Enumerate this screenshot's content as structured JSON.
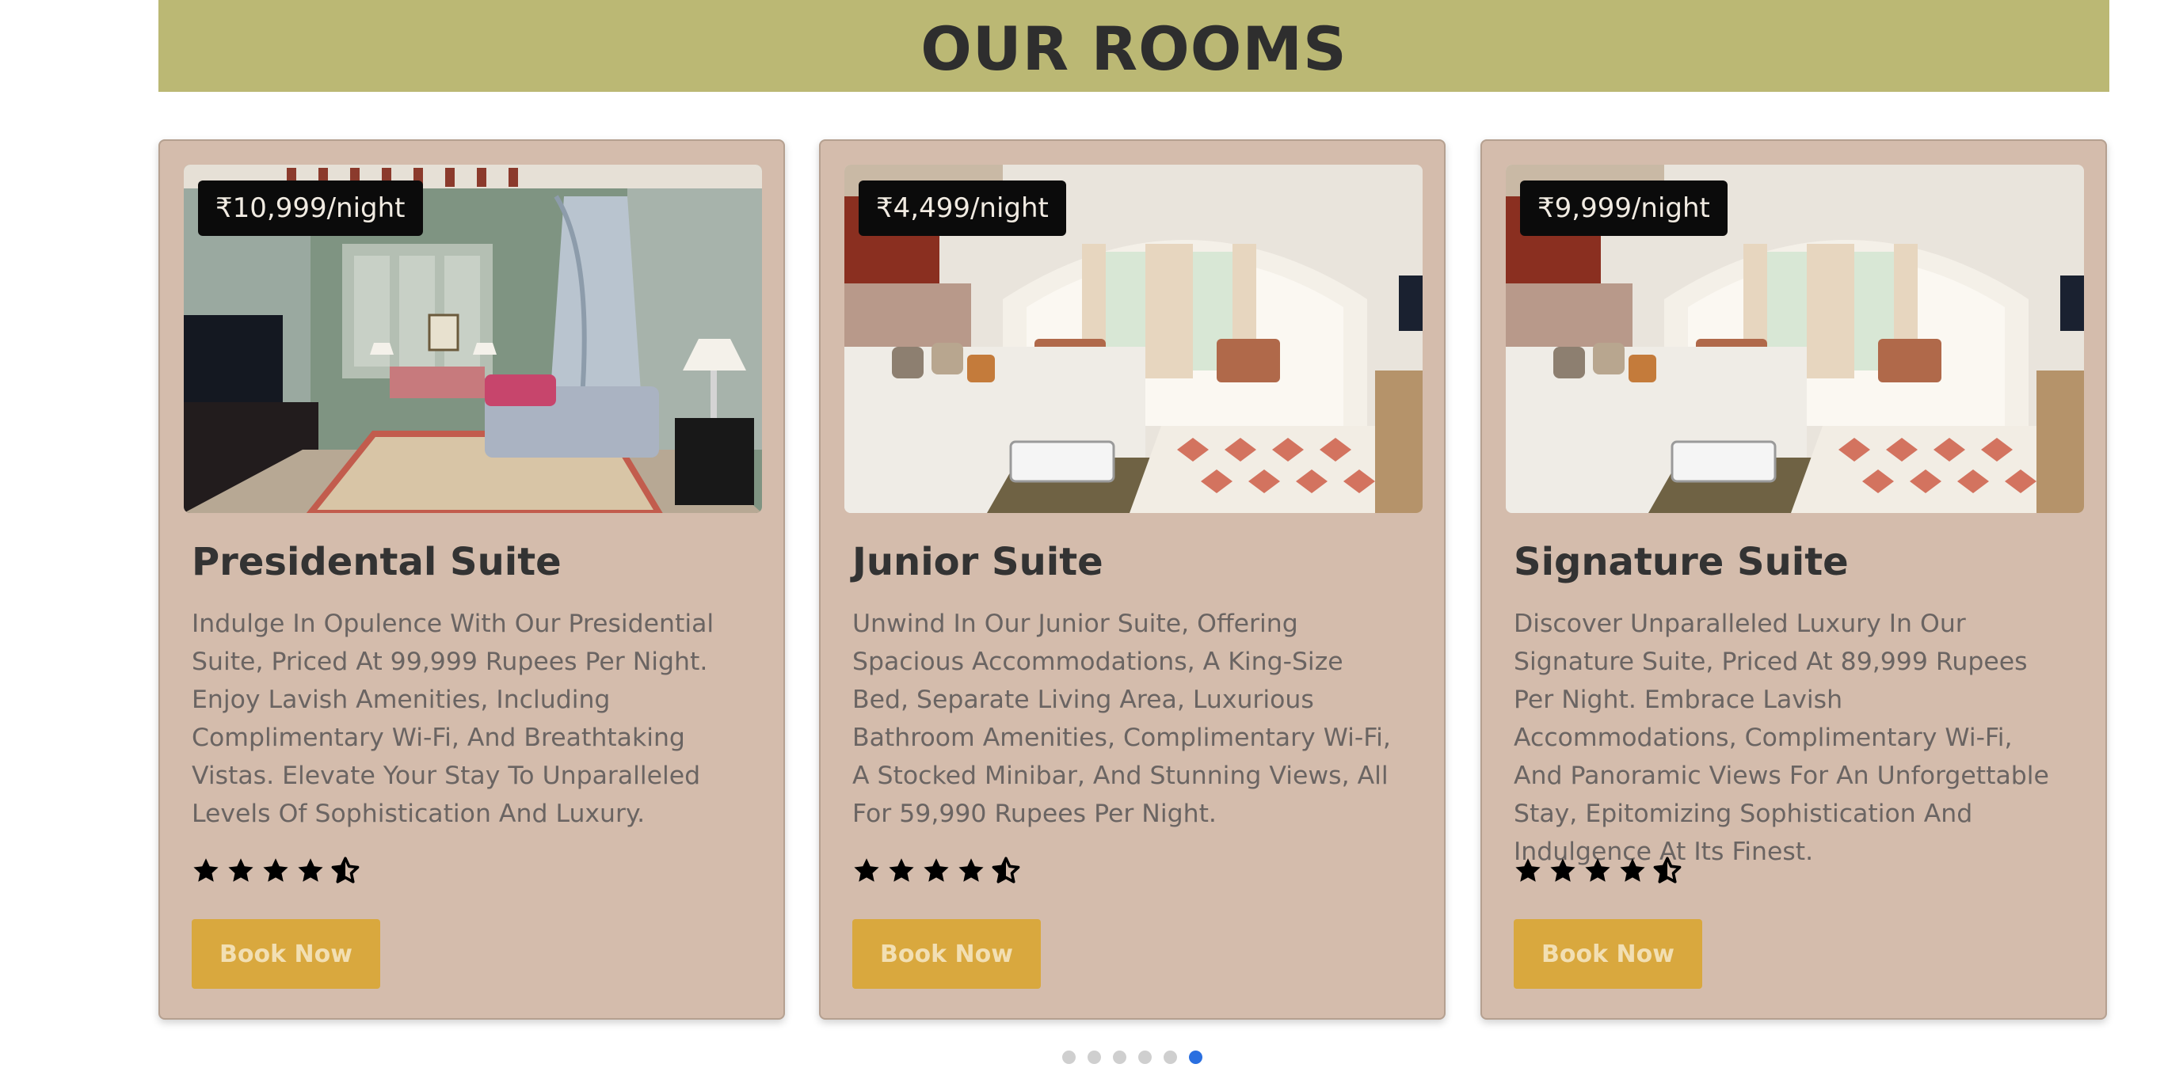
{
  "header": {
    "title": "OUR ROOMS"
  },
  "colors": {
    "header_bg": "#bbb874",
    "card_bg": "#d4bcac",
    "button_bg": "#d9a83e",
    "badge_bg": "#0b0b0b",
    "dot_active": "#2a6fe0",
    "dot_inactive": "#cfcfcf"
  },
  "rooms": [
    {
      "price": "₹10,999/night",
      "title": "Presidental Suite",
      "description": "Indulge In Opulence With Our Presidential Suite, Priced At 99,999 Rupees Per Night. Enjoy Lavish Amenities, Including Complimentary Wi-Fi, And Breathtaking Vistas. Elevate Your Stay To Unparalleled Levels Of Sophistication And Luxury.",
      "rating": 4.5,
      "rating_max": 5,
      "button_label": "Book Now",
      "image_icon": "bedroom-photo"
    },
    {
      "price": "₹4,499/night",
      "title": "Junior Suite",
      "description": "Unwind In Our Junior Suite, Offering Spacious Accommodations, A King-Size Bed, Separate Living Area, Luxurious Bathroom Amenities, Complimentary Wi-Fi, A Stocked Minibar, And Stunning Views, All For 59,990 Rupees Per Night.",
      "rating": 4.5,
      "rating_max": 5,
      "button_label": "Book Now",
      "image_icon": "bedroom-photo"
    },
    {
      "price": "₹9,999/night",
      "title": "Signature Suite",
      "description": "Discover Unparalleled Luxury In Our Signature Suite, Priced At 89,999 Rupees Per Night. Embrace Lavish Accommodations, Complimentary Wi-Fi, And Panoramic Views For An Unforgettable Stay, Epitomizing Sophistication And Indulgence At Its Finest.",
      "rating": 4.5,
      "rating_max": 5,
      "button_label": "Book Now",
      "image_icon": "bedroom-photo"
    }
  ],
  "carousel": {
    "total_slides": 6,
    "active_index": 5
  }
}
